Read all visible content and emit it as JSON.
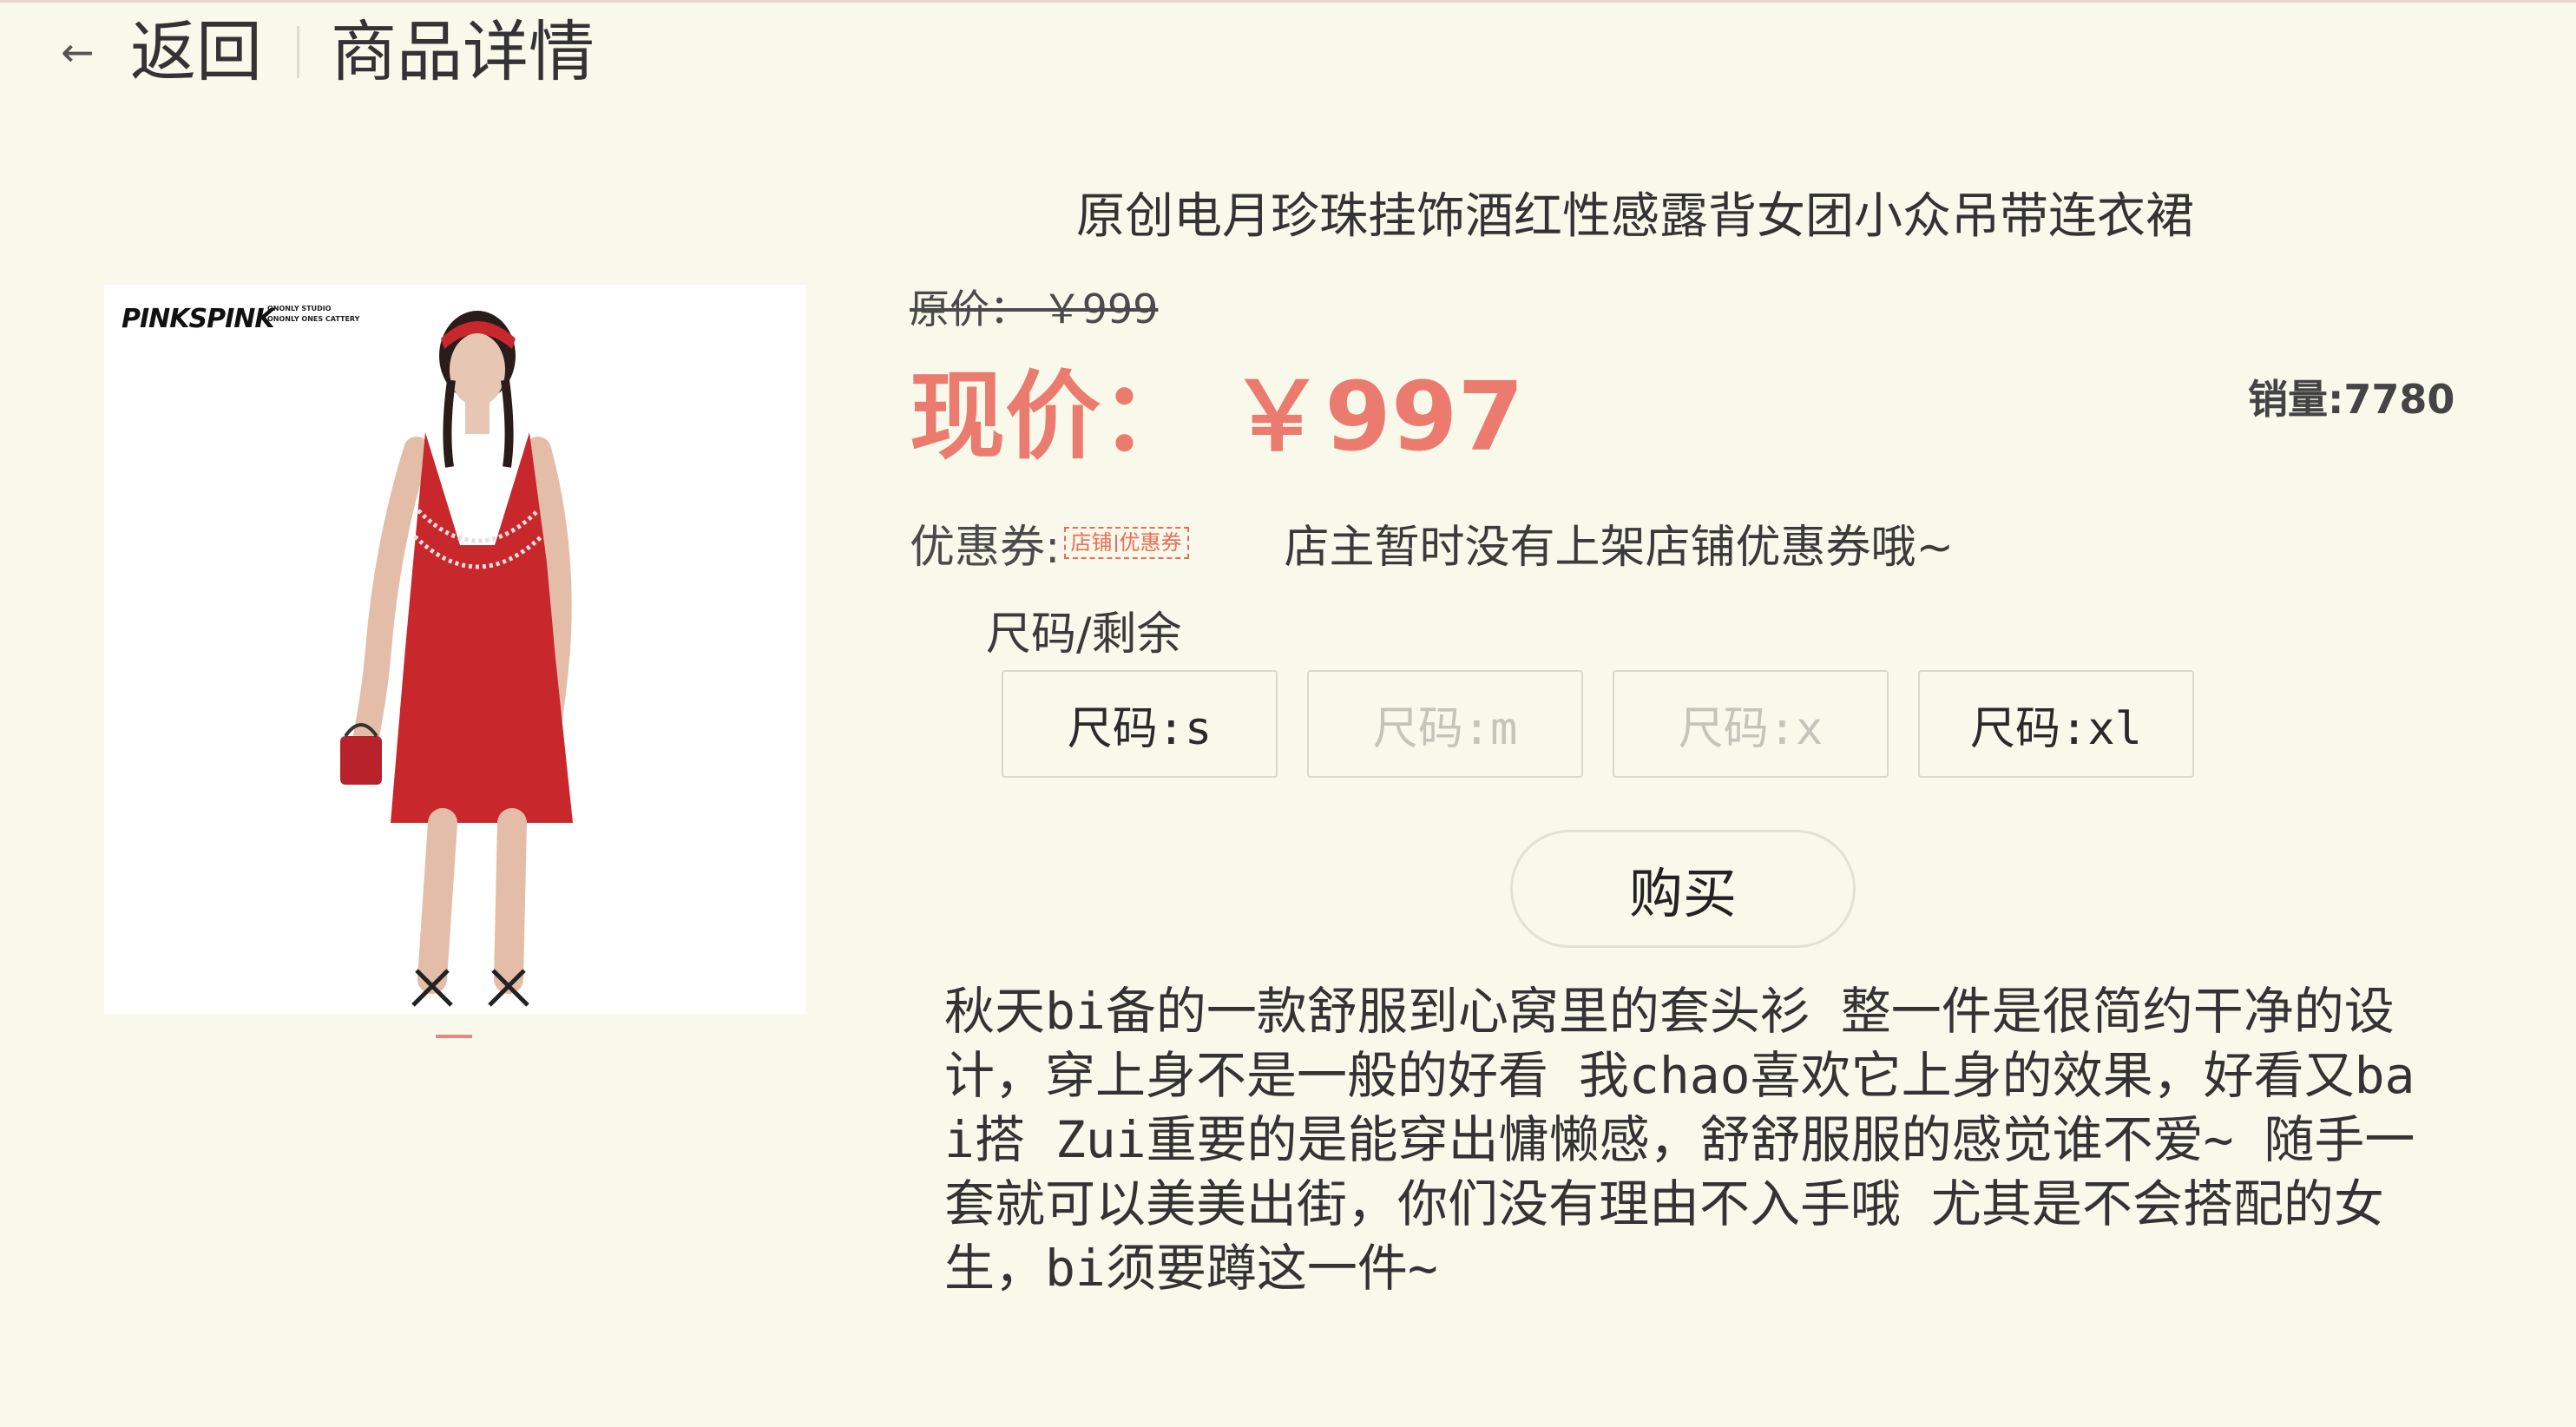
{
  "header": {
    "back_icon": "arrow-left-icon",
    "back_label": "返回",
    "title": "商品详情"
  },
  "product": {
    "name": "原创电月珍珠挂饰酒红性感露背女团小众吊带连衣裙",
    "original_price": "原价： ￥999",
    "current_price": "现价： ￥997",
    "sales": "销量:7780",
    "image": {
      "brand_logo": "PINKSPINK",
      "brand_sub": "ONONLY STUDIO ONONLY ONES CATTERY",
      "colors": {
        "dress": "#c8282c",
        "background": "#ffffff"
      }
    },
    "carousel_index": 1
  },
  "coupon": {
    "label": "优惠券:",
    "tag_left": "店铺",
    "tag_right": "优惠券",
    "message": "店主暂时没有上架店铺优惠券哦~"
  },
  "sizes": {
    "header": "尺码/剩余",
    "options": [
      {
        "label": "尺码:s",
        "available": true
      },
      {
        "label": "尺码:m",
        "available": false
      },
      {
        "label": "尺码:x",
        "available": false
      },
      {
        "label": "尺码:xl",
        "available": true
      }
    ]
  },
  "buy_label": "购买",
  "description": "秋天bi备的一款舒服到心窝里的套头衫 整一件是很简约干净的设计，穿上身不是一般的好看 我chao喜欢它上身的效果，好看又bai搭 Zui重要的是能穿出慵懒感，舒舒服服的感觉谁不爱~ 随手一套就可以美美出街，你们没有理由不入手哦 尤其是不会搭配的女生，bi须要蹲这一件~",
  "colors": {
    "background": "#f8f9ea",
    "price_accent": "#ec7b6f",
    "coupon_accent": "#ec6d56",
    "disabled_text": "#c4c4bb"
  }
}
